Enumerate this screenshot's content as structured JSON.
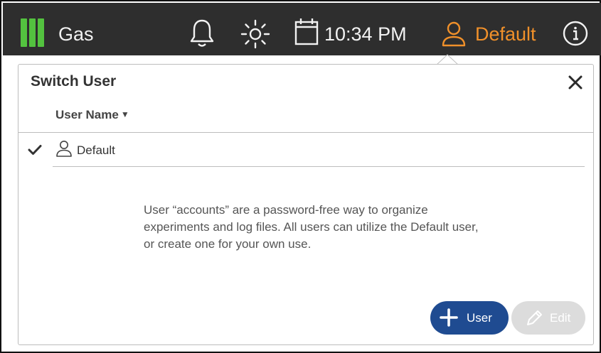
{
  "topbar": {
    "app_title": "Gas",
    "time": "10:34 PM",
    "current_user": "Default",
    "accent_color": "#f0902a",
    "gauge_color": "#53c23f",
    "icons": [
      "gauge-icon",
      "bell-icon",
      "brightness-icon",
      "calendar-icon",
      "user-icon",
      "info-icon"
    ]
  },
  "dialog": {
    "title": "Switch User",
    "column_header": "User Name",
    "sort_indicator": "▼",
    "users": [
      {
        "name": "Default",
        "selected": true
      }
    ],
    "info_text": "User “accounts” are a password-free way to organize experiments and log files. All users can utilize the Default user, or create one for your own use.",
    "add_button_label": "User",
    "edit_button_label": "Edit",
    "edit_enabled": false,
    "primary_color": "#1f4b91"
  }
}
